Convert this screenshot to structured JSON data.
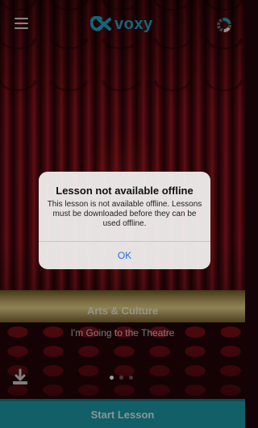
{
  "header": {
    "menu_icon": "hamburger-menu-icon",
    "logo_text": "voxy",
    "progress_icon": "progress-ring-icon",
    "brand_color": "#1ba6c8"
  },
  "lesson": {
    "category": "Arts & Culture",
    "title": "I'm Going to the Theatre",
    "download_icon": "download-icon",
    "pager": {
      "total": 3,
      "active_index": 0
    }
  },
  "footer": {
    "start_label": "Start Lesson",
    "accent_color": "#1d9aa6"
  },
  "alert": {
    "title": "Lesson not available offline",
    "message": "This lesson is not available offline. Lessons must be downloaded before they can be used offline.",
    "ok_label": "OK",
    "button_color": "#1f6fe6"
  }
}
